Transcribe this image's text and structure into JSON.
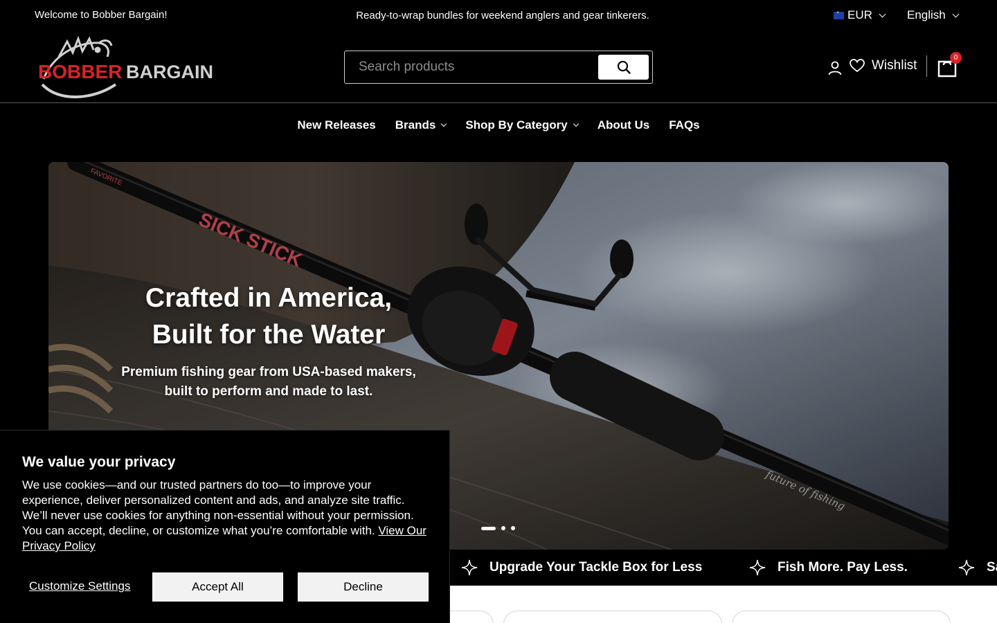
{
  "topbar": {
    "welcome": "Welcome to Bobber Bargain!",
    "promo": "Ready-to-wrap bundles for weekend anglers and gear tinkerers.",
    "currency": "EUR",
    "language": "English"
  },
  "header": {
    "logo_text_1": "BOBBER",
    "logo_text_2": "BARGAIN",
    "search_placeholder": "Search products",
    "wishlist_label": "Wishlist",
    "cart_count": "0"
  },
  "nav": {
    "items": [
      {
        "label": "New Releases",
        "has_dropdown": false
      },
      {
        "label": "Brands",
        "has_dropdown": true
      },
      {
        "label": "Shop By Category",
        "has_dropdown": true
      },
      {
        "label": "About Us",
        "has_dropdown": false
      },
      {
        "label": "FAQs",
        "has_dropdown": false
      }
    ]
  },
  "hero": {
    "title_line1": "Crafted in America,",
    "title_line2": "Built for the Water",
    "subtitle_line1": "Premium fishing gear from USA-based makers,",
    "subtitle_line2": "built to perform and made to last.",
    "slide_count": 3,
    "active_slide": 1,
    "rod_text": "SICK STICK",
    "rod_brand": "FAVORITE",
    "rod_tagline": "future of fishing"
  },
  "marquee": {
    "items": [
      "Upgrade Your Tackle Box for Less",
      "Fish More. Pay Less.",
      "Sa"
    ]
  },
  "cookie": {
    "title": "We value your privacy",
    "body": "We use cookies—and our trusted partners do too—to improve your experience, deliver personalized content and ads, and analyze site traffic. We’ll never use cookies for anything non-essential without your permission. You can accept, decline, or customize what you’re comfortable with. ",
    "policy_link": "View Our Privacy Policy",
    "customize_label": "Customize Settings",
    "accept_label": "Accept All",
    "decline_label": "Decline"
  },
  "colors": {
    "background": "#000000",
    "accent_red": "#d8222a",
    "text": "#ffffff"
  }
}
